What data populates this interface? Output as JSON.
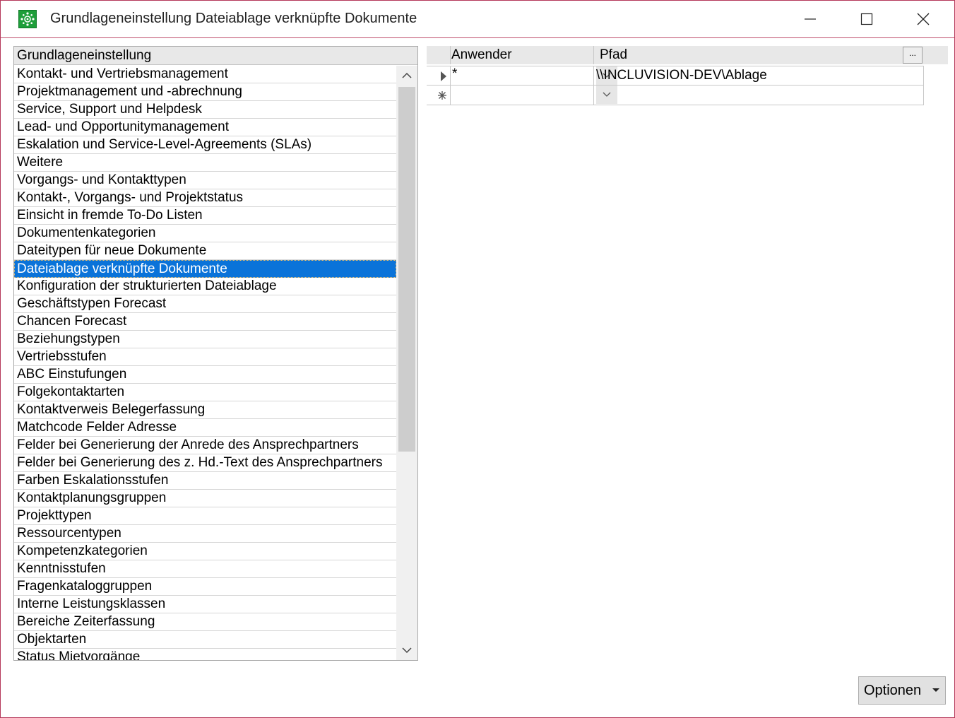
{
  "window": {
    "title": "Grundlageneinstellung Dateiablage verknüpfte Dokumente",
    "icon": "gear-network-icon",
    "accent_color": "#b5385a"
  },
  "list": {
    "header": "Grundlageneinstellung",
    "selected_index": 11,
    "selection_color": "#0a73d9",
    "items": [
      "Kontakt- und Vertriebsmanagement",
      "Projektmanagement und -abrechnung",
      "Service, Support und Helpdesk",
      "Lead- und Opportunitymanagement",
      "Eskalation und Service-Level-Agreements (SLAs)",
      "Weitere",
      "Vorgangs- und Kontakttypen",
      "Kontakt-, Vorgangs- und Projektstatus",
      "Einsicht in fremde To-Do Listen",
      "Dokumentenkategorien",
      "Dateitypen für neue Dokumente",
      "Dateiablage verknüpfte Dokumente",
      "Konfiguration der strukturierten Dateiablage",
      "Geschäftstypen Forecast",
      "Chancen Forecast",
      "Beziehungstypen",
      "Vertriebsstufen",
      "ABC Einstufungen",
      "Folgekontaktarten",
      "Kontaktverweis Belegerfassung",
      "Matchcode Felder Adresse",
      "Felder bei Generierung der Anrede des Ansprechpartners",
      "Felder bei Generierung des z. Hd.-Text des Ansprechpartners",
      "Farben Eskalationsstufen",
      "Kontaktplanungsgruppen",
      "Projekttypen",
      "Ressourcentypen",
      "Kompetenzkategorien",
      "Kenntnisstufen",
      "Fragenkataloggruppen",
      "Interne Leistungsklassen",
      "Bereiche Zeiterfassung",
      "Objektarten",
      "Status Mietvorgänge"
    ]
  },
  "grid": {
    "columns": {
      "anwender": "Anwender",
      "pfad": "Pfad",
      "browse": "..."
    },
    "rows": [
      {
        "indicator": "current-row-arrow-icon",
        "anwender": "*",
        "pfad": "\\\\INCLUVISION-DEV\\Ablage"
      },
      {
        "indicator": "new-row-asterisk-icon",
        "anwender": "",
        "pfad": ""
      }
    ]
  },
  "buttons": {
    "optionen": "Optionen"
  }
}
